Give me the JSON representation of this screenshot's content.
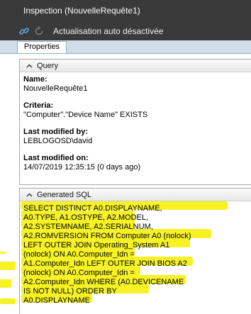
{
  "window": {
    "title": "Inspection (NouvelleRequête1)"
  },
  "toolbar": {
    "link_icon": "link-icon",
    "refresh_icon": "refresh-icon",
    "auto_refresh_label": "Actualisation auto désactivée"
  },
  "tabs": [
    {
      "label": "Properties",
      "selected": true
    }
  ],
  "query_panel": {
    "title": "Query",
    "fields": {
      "name_label": "Name:",
      "name_value": "NouvelleRequête1",
      "criteria_label": "Criteria:",
      "criteria_value": "\"Computer\".\"Device Name\" EXISTS",
      "last_modified_by_label": "Last modified by:",
      "last_modified_by_value": "LEBLOGOSD\\david",
      "last_modified_on_label": "Last modified on:",
      "last_modified_on_value": "14/07/2019 12:35:15 (0 days ago)"
    }
  },
  "sql_panel": {
    "title": "Generated SQL",
    "sql": "SELECT DISTINCT A0.DISPLAYNAME,\nA0.TYPE, A1.OSTYPE, A2.MODEL,\nA2.SYSTEMNAME, A2.SERIALNUM,\nA2.ROMVERSION  FROM Computer A0 (nolock)\nLEFT OUTER JOIN Operating_System A1\n(nolock) ON A0.Computer_Idn =\nA1.Computer_Idn LEFT OUTER JOIN BIOS A2\n(nolock) ON A0.Computer_Idn =\nA2.Computer_Idn  WHERE (A0.DEVICENAME\nIS NOT NULL)  ORDER BY\nA0.DISPLAYNAME"
  },
  "colors": {
    "titlebar_bg": "#3a3a3a",
    "tabstrip_bg": "#cfdde9",
    "highlight": "#f5f000"
  }
}
